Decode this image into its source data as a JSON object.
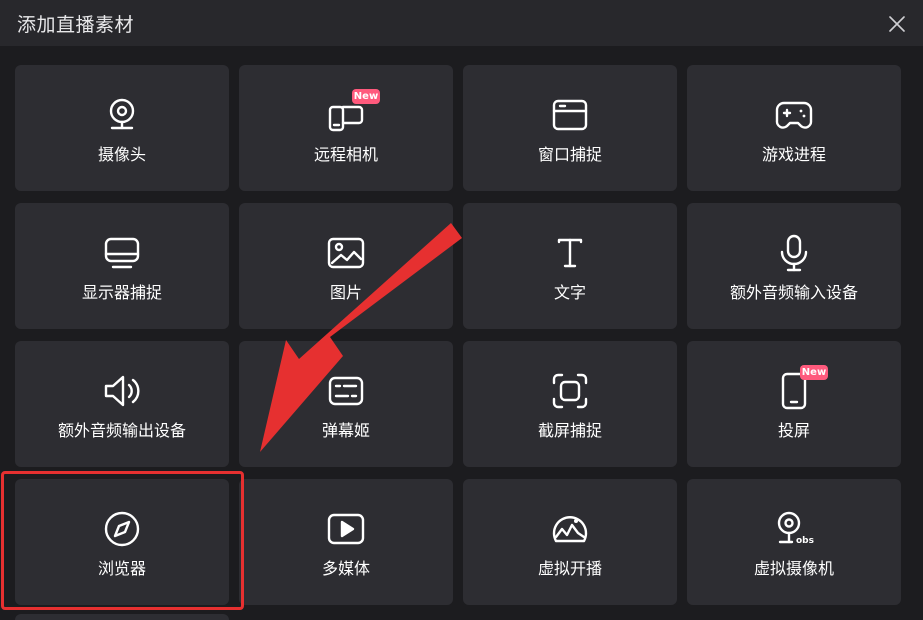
{
  "dialog": {
    "title": "添加直播素材",
    "close_icon": "close-icon"
  },
  "tiles": [
    {
      "label": "摄像头",
      "icon": "camera-icon"
    },
    {
      "label": "远程相机",
      "icon": "remote-camera-icon",
      "badge": "New"
    },
    {
      "label": "窗口捕捉",
      "icon": "window-capture-icon"
    },
    {
      "label": "游戏进程",
      "icon": "gamepad-icon"
    },
    {
      "label": "显示器捕捉",
      "icon": "monitor-icon"
    },
    {
      "label": "图片",
      "icon": "image-icon"
    },
    {
      "label": "文字",
      "icon": "text-icon"
    },
    {
      "label": "额外音频输入设备",
      "icon": "microphone-icon"
    },
    {
      "label": "额外音频输出设备",
      "icon": "speaker-icon"
    },
    {
      "label": "弹幕姬",
      "icon": "danmaku-icon"
    },
    {
      "label": "截屏捕捉",
      "icon": "screenshot-icon"
    },
    {
      "label": "投屏",
      "icon": "phone-cast-icon",
      "badge": "New"
    },
    {
      "label": "浏览器",
      "icon": "compass-icon"
    },
    {
      "label": "多媒体",
      "icon": "play-icon"
    },
    {
      "label": "虚拟开播",
      "icon": "virtual-avatar-icon"
    },
    {
      "label": "虚拟摄像机",
      "icon": "obs-camera-icon",
      "icon_text": "obs"
    }
  ],
  "colors": {
    "background": "#1c1c1f",
    "tile": "#2d2d32",
    "badge": "#ff5a7d",
    "annotation_red": "#e63030"
  }
}
